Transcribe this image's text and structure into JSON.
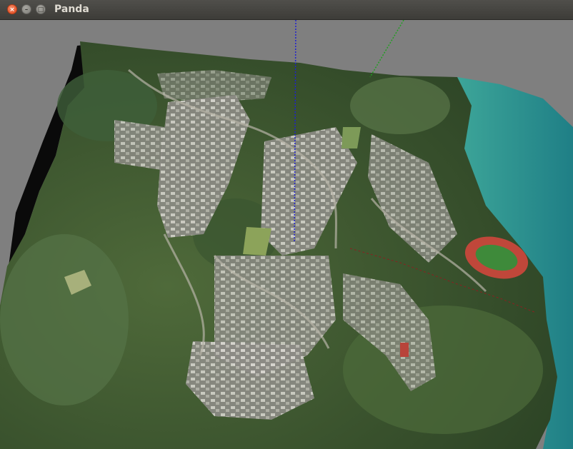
{
  "window": {
    "title": "Panda",
    "close_glyph": "×",
    "minimize_glyph": "–",
    "maximize_glyph": "□"
  },
  "scene": {
    "background_color": "#7f7f7f",
    "content": "aerial-photogrammetry-terrain-mesh",
    "axis_colors": {
      "z_axis": "#2020d0",
      "y_axis": "#20a020",
      "x_axis": "#c03030"
    }
  }
}
